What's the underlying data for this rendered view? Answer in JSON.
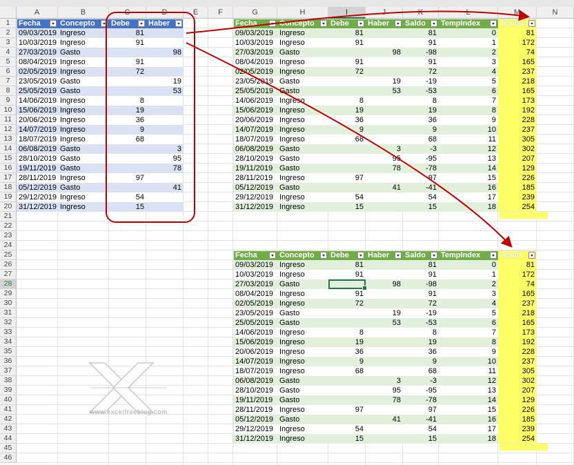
{
  "columns": [
    "A",
    "B",
    "C",
    "D",
    "E",
    "F",
    "G",
    "H",
    "I",
    "J",
    "K",
    "L",
    "M",
    "N"
  ],
  "selected_column": "I",
  "selected_row": 28,
  "rows": [
    1,
    2,
    3,
    4,
    5,
    6,
    7,
    8,
    9,
    10,
    11,
    12,
    13,
    14,
    15,
    16,
    17,
    18,
    19,
    20,
    21,
    22,
    23,
    24,
    25,
    26,
    27,
    28,
    29,
    30,
    31,
    32,
    33,
    34,
    35,
    36,
    37,
    38,
    39,
    40,
    41,
    42,
    43,
    44,
    45,
    46
  ],
  "source_table": {
    "headers": [
      "Fecha",
      "Concepto",
      "Debe",
      "Haber"
    ],
    "rows": [
      [
        "09/03/2019",
        "Ingreso",
        "81",
        ""
      ],
      [
        "10/03/2019",
        "Ingreso",
        "91",
        ""
      ],
      [
        "27/03/2019",
        "Gasto",
        "",
        "98"
      ],
      [
        "08/04/2019",
        "Ingreso",
        "91",
        ""
      ],
      [
        "02/05/2019",
        "Ingreso",
        "72",
        ""
      ],
      [
        "23/05/2019",
        "Gasto",
        "",
        "19"
      ],
      [
        "25/05/2019",
        "Gasto",
        "",
        "53"
      ],
      [
        "14/06/2019",
        "Ingreso",
        "8",
        ""
      ],
      [
        "15/06/2019",
        "Ingreso",
        "19",
        ""
      ],
      [
        "20/06/2019",
        "Ingreso",
        "36",
        ""
      ],
      [
        "14/07/2019",
        "Ingreso",
        "9",
        ""
      ],
      [
        "18/07/2019",
        "Ingreso",
        "68",
        ""
      ],
      [
        "06/08/2019",
        "Gasto",
        "",
        "3"
      ],
      [
        "28/10/2019",
        "Gasto",
        "",
        "95"
      ],
      [
        "19/11/2019",
        "Gasto",
        "",
        "78"
      ],
      [
        "28/11/2019",
        "Ingreso",
        "97",
        ""
      ],
      [
        "05/12/2019",
        "Gasto",
        "",
        "41"
      ],
      [
        "29/12/2019",
        "Ingreso",
        "54",
        ""
      ],
      [
        "31/12/2019",
        "Ingreso",
        "15",
        ""
      ]
    ]
  },
  "result_table_1": {
    "headers": [
      "Fecha",
      "Concepto",
      "Debe",
      "Haber",
      "Saldo",
      "TempIndex",
      "Acumu"
    ],
    "rows": [
      [
        "09/03/2019",
        "Ingreso",
        "81",
        "",
        "81",
        "0",
        "81"
      ],
      [
        "10/03/2019",
        "Ingreso",
        "91",
        "",
        "91",
        "1",
        "172"
      ],
      [
        "27/03/2019",
        "Gasto",
        "",
        "98",
        "-98",
        "2",
        "74"
      ],
      [
        "08/04/2019",
        "Ingreso",
        "91",
        "",
        "91",
        "3",
        "165"
      ],
      [
        "02/05/2019",
        "Ingreso",
        "72",
        "",
        "72",
        "4",
        "237"
      ],
      [
        "23/05/2019",
        "Gasto",
        "",
        "19",
        "-19",
        "5",
        "218"
      ],
      [
        "25/05/2019",
        "Gasto",
        "",
        "53",
        "-53",
        "6",
        "165"
      ],
      [
        "14/06/2019",
        "Ingreso",
        "8",
        "",
        "8",
        "7",
        "173"
      ],
      [
        "15/06/2019",
        "Ingreso",
        "19",
        "",
        "19",
        "8",
        "192"
      ],
      [
        "20/06/2019",
        "Ingreso",
        "36",
        "",
        "36",
        "9",
        "228"
      ],
      [
        "14/07/2019",
        "Ingreso",
        "9",
        "",
        "9",
        "10",
        "237"
      ],
      [
        "18/07/2019",
        "Ingreso",
        "68",
        "",
        "68",
        "11",
        "305"
      ],
      [
        "06/08/2019",
        "Gasto",
        "",
        "3",
        "-3",
        "12",
        "302"
      ],
      [
        "28/10/2019",
        "Gasto",
        "",
        "95",
        "-95",
        "13",
        "207"
      ],
      [
        "19/11/2019",
        "Gasto",
        "",
        "78",
        "-78",
        "14",
        "129"
      ],
      [
        "28/11/2019",
        "Ingreso",
        "97",
        "",
        "97",
        "15",
        "226"
      ],
      [
        "05/12/2019",
        "Gasto",
        "",
        "41",
        "-41",
        "16",
        "185"
      ],
      [
        "29/12/2019",
        "Ingreso",
        "54",
        "",
        "54",
        "17",
        "239"
      ],
      [
        "31/12/2019",
        "Ingreso",
        "15",
        "",
        "15",
        "18",
        "254"
      ]
    ]
  },
  "result_table_2": {
    "headers": [
      "Fecha",
      "Concepto",
      "Debe",
      "Haber",
      "Saldo",
      "TempIndex",
      "Acum"
    ],
    "rows": [
      [
        "09/03/2019",
        "Ingreso",
        "81",
        "",
        "81",
        "0",
        "81"
      ],
      [
        "10/03/2019",
        "Ingreso",
        "91",
        "",
        "91",
        "1",
        "172"
      ],
      [
        "27/03/2019",
        "Gasto",
        "",
        "98",
        "-98",
        "2",
        "74"
      ],
      [
        "08/04/2019",
        "Ingreso",
        "91",
        "",
        "91",
        "3",
        "165"
      ],
      [
        "02/05/2019",
        "Ingreso",
        "72",
        "",
        "72",
        "4",
        "237"
      ],
      [
        "23/05/2019",
        "Gasto",
        "",
        "19",
        "-19",
        "5",
        "218"
      ],
      [
        "25/05/2019",
        "Gasto",
        "",
        "53",
        "-53",
        "6",
        "165"
      ],
      [
        "14/06/2019",
        "Ingreso",
        "8",
        "",
        "8",
        "7",
        "173"
      ],
      [
        "15/06/2019",
        "Ingreso",
        "19",
        "",
        "19",
        "8",
        "192"
      ],
      [
        "20/06/2019",
        "Ingreso",
        "36",
        "",
        "36",
        "9",
        "228"
      ],
      [
        "14/07/2019",
        "Ingreso",
        "9",
        "",
        "9",
        "10",
        "237"
      ],
      [
        "18/07/2019",
        "Ingreso",
        "68",
        "",
        "68",
        "11",
        "305"
      ],
      [
        "06/08/2019",
        "Gasto",
        "",
        "3",
        "-3",
        "12",
        "302"
      ],
      [
        "28/10/2019",
        "Gasto",
        "",
        "95",
        "-95",
        "13",
        "207"
      ],
      [
        "19/11/2019",
        "Gasto",
        "",
        "78",
        "-78",
        "14",
        "129"
      ],
      [
        "28/11/2019",
        "Ingreso",
        "97",
        "",
        "97",
        "15",
        "226"
      ],
      [
        "05/12/2019",
        "Gasto",
        "",
        "41",
        "-41",
        "16",
        "185"
      ],
      [
        "29/12/2019",
        "Ingreso",
        "54",
        "",
        "54",
        "17",
        "239"
      ],
      [
        "31/12/2019",
        "Ingreso",
        "15",
        "",
        "15",
        "18",
        "254"
      ]
    ]
  },
  "watermark": {
    "text": "www.excelfreeblog.com",
    "icon": "excel-x-logo"
  },
  "colors": {
    "source_header": "#4472c4",
    "source_band": "#d9e1f2",
    "result_header": "#70ad47",
    "result_band": "#e2efda",
    "highlight": "#ffff66",
    "annotation": "#c00000",
    "selection": "#217346"
  }
}
